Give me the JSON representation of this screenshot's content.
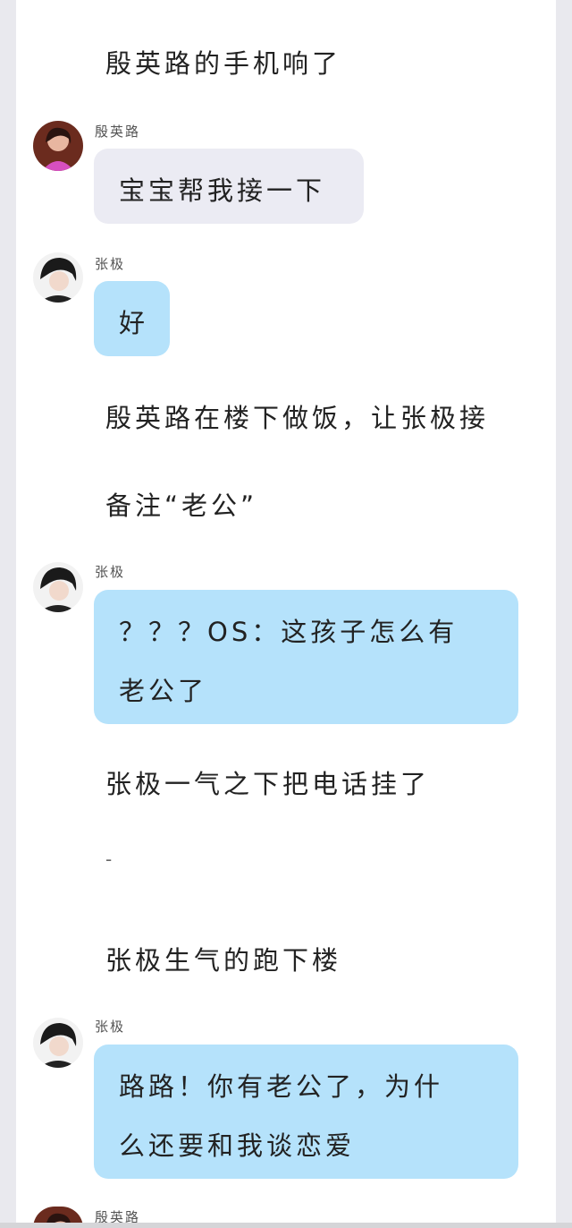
{
  "story": {
    "narration_1": "殷英路的手机响了",
    "narration_2": "殷英路在楼下做饭，让张极接",
    "narration_3": "备注“老公”",
    "narration_4": "张极一气之下把电话挂了",
    "narration_5": "-",
    "narration_6": "张极生气的跑下楼"
  },
  "messages": [
    {
      "sender": "殷英路",
      "lines": [
        "宝宝帮我接一下"
      ],
      "style": "grey"
    },
    {
      "sender": "张极",
      "lines": [
        "好"
      ],
      "style": "blue"
    },
    {
      "sender": "张极",
      "lines": [
        "？？？OS：这孩子怎么有",
        "老公了"
      ],
      "style": "blue"
    },
    {
      "sender": "张极",
      "lines": [
        "路路！你有老公了，为什",
        "么还要和我谈恋爱"
      ],
      "style": "blue"
    },
    {
      "sender": "殷英路",
      "lines": [],
      "style": "grey"
    }
  ],
  "colors": {
    "bubble_grey": "#ebebf3",
    "bubble_blue": "#b5e2fb",
    "background": "#ffffff"
  }
}
